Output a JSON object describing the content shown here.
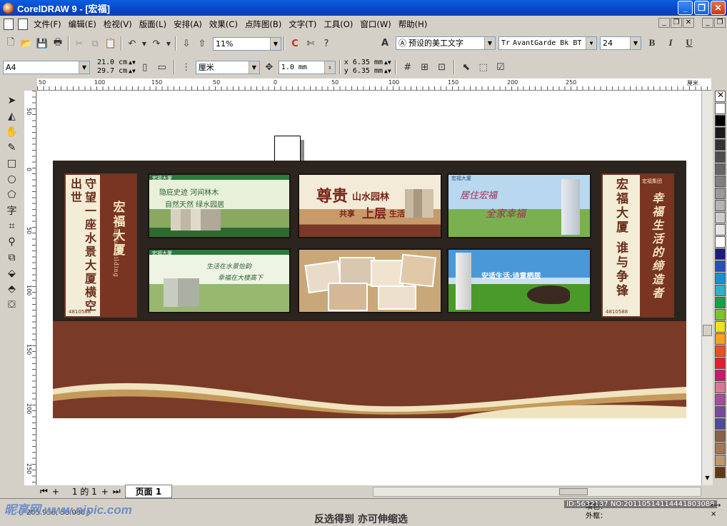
{
  "window": {
    "title": "CorelDRAW 9 - [宏福]",
    "minimize": "_",
    "restore": "❐",
    "close": "✕"
  },
  "menu": {
    "items": [
      "文件(F)",
      "编辑(E)",
      "检视(V)",
      "版面(L)",
      "安排(A)",
      "效果(C)",
      "点阵图(B)",
      "文字(T)",
      "工具(O)",
      "窗口(W)",
      "帮助(H)"
    ]
  },
  "text_toolbar": {
    "style_value": "预设的美工文字",
    "font_value": "AvantGarde Bk BT",
    "size_value": "24",
    "bold": "B",
    "italic": "I",
    "underline": "U"
  },
  "standard_toolbar": {
    "zoom_value": "11%"
  },
  "property_bar": {
    "paper_value": "A4",
    "width_value": "21.0 cm",
    "height_value": "29.7 cm",
    "units_value": "厘米",
    "nudge_value": "1.0 mm",
    "dup_x": "6.35 mm",
    "dup_y": "6.35 mm"
  },
  "ruler": {
    "unit": "厘米",
    "h_ticks": [
      "50",
      "100",
      "150",
      "50",
      "0",
      "50",
      "100",
      "150",
      "200",
      "250"
    ],
    "v_ticks": [
      "50",
      "0",
      "50",
      "100",
      "150",
      "200",
      "250"
    ]
  },
  "design": {
    "left_banner": {
      "col1": "守望一座水景大厦横空出世",
      "col2": "宏福大厦",
      "col2_en": "Hongfu Building",
      "phone": "4810588"
    },
    "right_banner": {
      "col1": "宏福大厦 谁与争锋",
      "col2": "幸福生活的缔造者",
      "tag": "宏福集团",
      "phone": "4810588"
    },
    "panels": [
      {
        "logo": "宏福大厦",
        "line1": "隐庇史迹 河间林木",
        "line2": "自然天然 绿水园居"
      },
      {
        "headline": "尊贵",
        "sub1": "山水园林",
        "sub2": "共享",
        "sub3": "上层",
        "sub4": "生活"
      },
      {
        "logo": "宏福大厦",
        "line1": "居住宏福",
        "line2": "全家幸福"
      },
      {
        "logo": "宏福大厦",
        "line1": "生活在水景怡韵",
        "line2": "幸福在大楼高下"
      },
      {},
      {
        "line1": "安适生活·诗意栖居"
      }
    ]
  },
  "page_nav": {
    "counter": "1 的 1",
    "tab": "页面 1"
  },
  "status": {
    "coords": "( -205.938, 58.086 )",
    "fill_label": "填色：",
    "outline_label": "外框：",
    "hint": "反选得到 亦可伸缩选"
  },
  "watermark": {
    "text": "昵享网 www.nipic.com",
    "id": "ID:5632137 NO:20110514114441803088"
  },
  "palette": [
    "#ffffff",
    "#000000",
    "#1a1a1a",
    "#333333",
    "#4d4d4d",
    "#666666",
    "#808080",
    "#999999",
    "#b3b3b3",
    "#cccccc",
    "#e6e6e6",
    "#ffffff",
    "#1c1c7a",
    "#2850b8",
    "#1890d0",
    "#30b0c8",
    "#18a048",
    "#80c030",
    "#f0e020",
    "#f8a020",
    "#e85020",
    "#e02030",
    "#c81870",
    "#d87898",
    "#a0509a",
    "#7848a0",
    "#504898",
    "#8a6048",
    "#a07858",
    "#c09870",
    "#603818"
  ]
}
